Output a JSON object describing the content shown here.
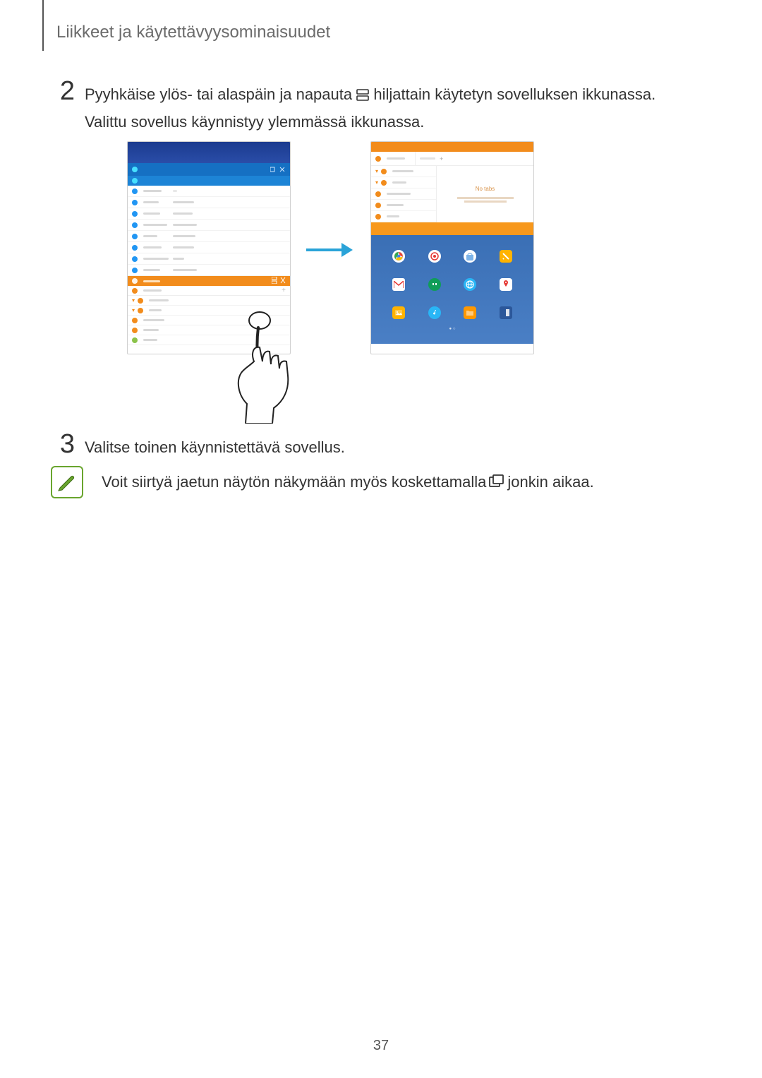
{
  "header": {
    "title": "Liikkeet ja käytettävyysominaisuudet"
  },
  "steps": {
    "s2": {
      "num": "2",
      "text_a": "Pyyhkäise ylös- tai alaspäin ja napauta ",
      "text_b": " hiljattain käytetyn sovelluksen ikkunassa.",
      "text_c": "Valittu sovellus käynnistyy ylemmässä ikkunassa."
    },
    "s3": {
      "num": "3",
      "text": "Valitse toinen käynnistettävä sovellus."
    }
  },
  "note": {
    "text_a": "Voit siirtyä jaetun näytön näkymään myös koskettamalla ",
    "text_b": " jonkin aikaa."
  },
  "figure": {
    "shot_b": {
      "tab_plus": "+",
      "message_label": "No tabs"
    },
    "icons": {
      "chrome": "chrome-icon",
      "target": "target-icon",
      "galaxy": "galaxy-apps-icon",
      "memo": "memo-icon",
      "gmail": "gmail-icon",
      "hangouts": "hangouts-icon",
      "globe": "browser-icon",
      "maps": "maps-icon",
      "gallery": "gallery-icon",
      "music": "music-icon",
      "files": "files-icon",
      "word": "word-icon"
    }
  },
  "page_number": "37"
}
